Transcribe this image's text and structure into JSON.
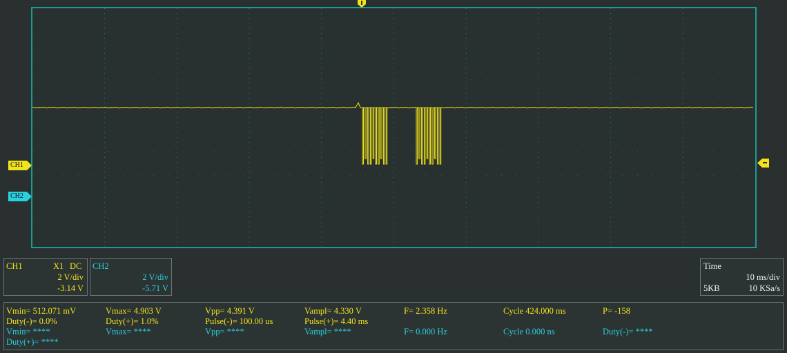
{
  "markers": {
    "ch1": "CH1",
    "ch2": "CH2"
  },
  "colors": {
    "ch1": "#f2e41c",
    "ch2": "#2ad0df",
    "frame": "#1c9c94",
    "grid": "#1c8c84",
    "background": "#2a2f2f"
  },
  "ch1_panel": {
    "name": "CH1",
    "probe": "X1",
    "coupling": "DC",
    "scale": "2 V/div",
    "offset": "-3.14 V"
  },
  "ch2_panel": {
    "name": "CH2",
    "scale": "2 V/div",
    "offset": "-5.71 V"
  },
  "time_panel": {
    "title": "Time",
    "timebase": "10 ms/div",
    "memory": "5KB",
    "sample_rate": "10 KSa/s"
  },
  "measurements": {
    "ch1": {
      "vmin": "Vmin= 512.071 mV",
      "vmax": "Vmax= 4.903 V",
      "vpp": "Vpp= 4.391 V",
      "vampl": "Vampl= 4.330 V",
      "freq": "F= 2.358 Hz",
      "cycle": "Cycle 424.000 ms",
      "pulses": "P= -158",
      "duty_neg": "Duty(-)= 0.0%",
      "duty_pos": "Duty(+)= 1.0%",
      "pulse_neg": "Pulse(-)= 100.00 us",
      "pulse_pos": "Pulse(+)= 4.40 ms"
    },
    "ch2": {
      "vmin": "Vmin= ****",
      "vmax": "Vmax= ****",
      "vpp": "Vpp= ****",
      "vampl": "Vampl= ****",
      "freq": "F= 0.000 Hz",
      "cycle": "Cycle 0.000 ns",
      "duty_neg": "Duty(-)= ****",
      "duty_pos": "Duty(+)= ****"
    }
  }
}
